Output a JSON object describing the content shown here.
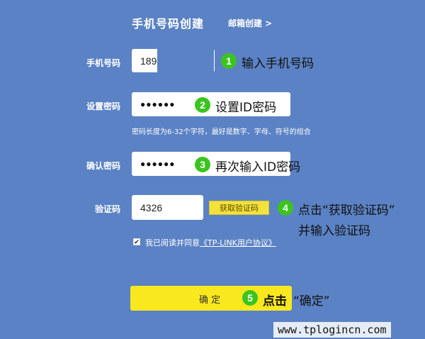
{
  "header": {
    "title": "手机号码创建",
    "email_link": "邮箱创建 >"
  },
  "form": {
    "phone_label": "手机号码",
    "phone_value": "189",
    "password_label": "设置密码",
    "password_value": "●●●●●●",
    "password_hint": "密码长度为6-32个字符，最好是数字、字母、符号的组合",
    "confirm_label": "确认密码",
    "confirm_value": "●●●●●●",
    "code_label": "验证码",
    "code_value": "4326",
    "get_code_button": "获取验证码",
    "agree_text": "我已阅读并同意",
    "agree_link": "《TP-LINK用户协议》",
    "submit_label": "确 定"
  },
  "annotations": [
    {
      "num": "1",
      "text": "输入手机号码"
    },
    {
      "num": "2",
      "text": "设置ID密码"
    },
    {
      "num": "3",
      "text": "再次输入ID密码"
    },
    {
      "num": "4",
      "text": "点击“获取验证码”",
      "text2": "并输入验证码"
    },
    {
      "num": "5",
      "text": "点击",
      "text2": "“确定”"
    }
  ],
  "watermark": "www.tplogincn.com",
  "colors": {
    "background": "#5b82c4",
    "badge": "#3cc41e",
    "button": "#f9e81e"
  }
}
